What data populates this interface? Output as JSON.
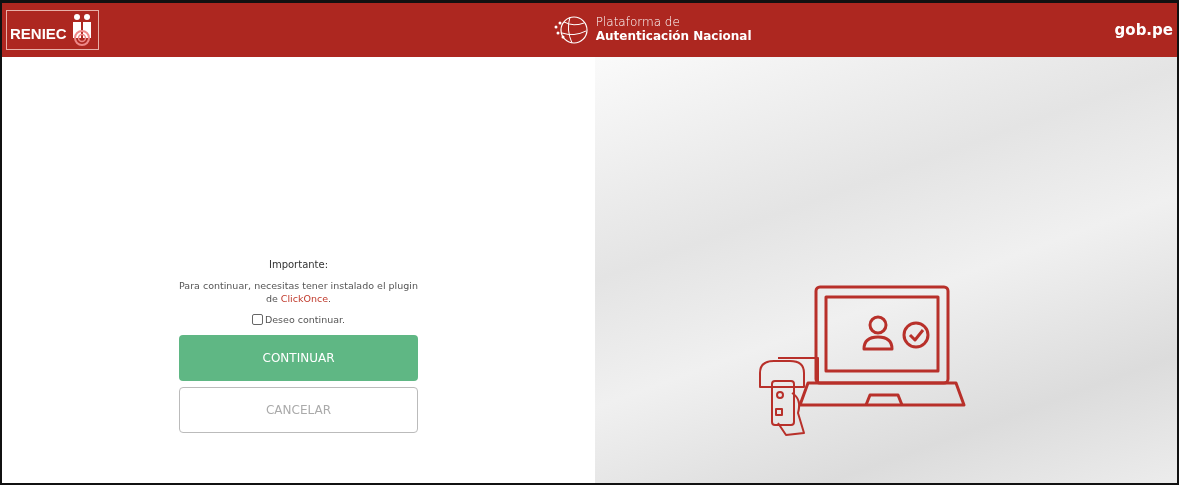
{
  "header": {
    "logo_text": "RENIEC",
    "platform_line1": "Plataforma de",
    "platform_line2": "Autenticación Nacional",
    "gov_link": "gob.pe"
  },
  "notice": {
    "title": "Importante:",
    "text_before": "Para continuar, necesitas tener instalado el plugin de",
    "link": "ClickOnce",
    "text_after": "."
  },
  "consent": {
    "label": "Deseo continuar.",
    "checked": false
  },
  "buttons": [
    {
      "kind": "primary",
      "label": "CONTINUAR"
    },
    {
      "kind": "secondary",
      "label": "CANCELAR"
    }
  ]
}
